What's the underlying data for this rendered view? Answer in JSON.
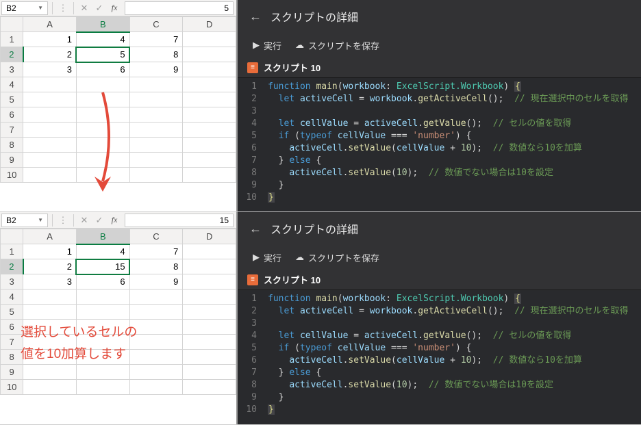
{
  "before": {
    "namebox": "B2",
    "formula_value": "5",
    "cols": [
      "A",
      "B",
      "C",
      "D"
    ],
    "rows": [
      "1",
      "2",
      "3",
      "4",
      "5",
      "6",
      "7",
      "8",
      "9",
      "10"
    ],
    "cells": {
      "A1": "1",
      "B1": "4",
      "C1": "7",
      "A2": "2",
      "B2": "5",
      "C2": "8",
      "A3": "3",
      "B3": "6",
      "C3": "9"
    },
    "active": "B2",
    "sel_col": "B",
    "sel_row": "2"
  },
  "after": {
    "namebox": "B2",
    "formula_value": "15",
    "cols": [
      "A",
      "B",
      "C",
      "D"
    ],
    "rows": [
      "1",
      "2",
      "3",
      "4",
      "5",
      "6",
      "7",
      "8",
      "9",
      "10"
    ],
    "cells": {
      "A1": "1",
      "B1": "4",
      "C1": "7",
      "A2": "2",
      "B2": "15",
      "C2": "8",
      "A3": "3",
      "B3": "6",
      "C3": "9"
    },
    "active": "B2",
    "sel_col": "B",
    "sel_row": "2"
  },
  "annotation": {
    "line1": "選択しているセルの",
    "line2": "値を10加算します"
  },
  "script_panel": {
    "title": "スクリプトの詳細",
    "run_label": "実行",
    "save_label": "スクリプトを保存",
    "script_name": "スクリプト 10",
    "line_numbers": [
      "1",
      "2",
      "3",
      "4",
      "5",
      "6",
      "7",
      "8",
      "9",
      "10"
    ],
    "code": {
      "l1": {
        "kw1": "function",
        "fn": "main",
        "id": "workbook",
        "ty": "ExcelScript.Workbook"
      },
      "l2": {
        "kw": "let",
        "id": "activeCell",
        "obj": "workbook",
        "fn": "getActiveCell",
        "cm": "// 現在選択中のセルを取得"
      },
      "l4": {
        "kw": "let",
        "id": "cellValue",
        "obj": "activeCell",
        "fn": "getValue",
        "cm": "// セルの値を取得"
      },
      "l5": {
        "kw1": "if",
        "kw2": "typeof",
        "id": "cellValue",
        "st": "'number'"
      },
      "l6": {
        "obj": "activeCell",
        "fn": "setValue",
        "id": "cellValue",
        "nu": "10",
        "cm": "// 数値なら10を加算"
      },
      "l7": {
        "kw": "else"
      },
      "l8": {
        "obj": "activeCell",
        "fn": "setValue",
        "nu": "10",
        "cm": "// 数値でない場合は10を設定"
      }
    }
  }
}
